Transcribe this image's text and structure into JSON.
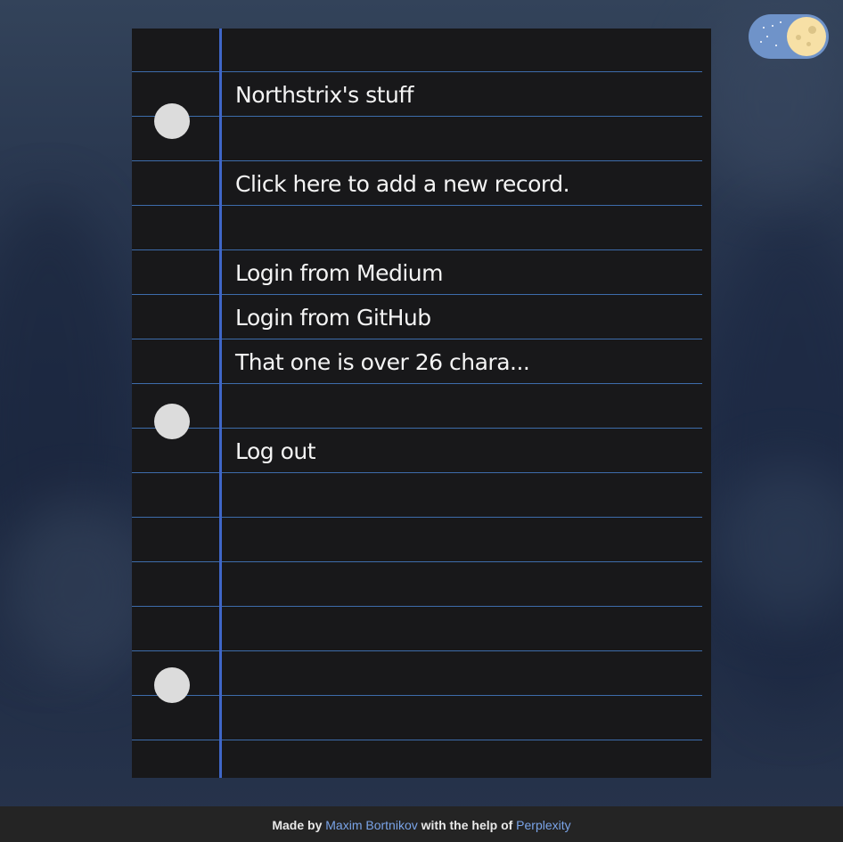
{
  "notebook": {
    "title": "Northstrix's stuff",
    "add_record": "Click here to add a new record.",
    "records": [
      "Login from Medium",
      "Login from GitHub",
      "That one is over 26 chara..."
    ],
    "logout": "Log out"
  },
  "footer": {
    "prefix": "Made by",
    "author": "Maxim Bortnikov",
    "middle": "with the help of",
    "helper": "Perplexity"
  },
  "colors": {
    "paper": "#18181a",
    "rule_line": "#3d6cab",
    "margin_line": "#3f66c8",
    "toggle_track": "#6f93c9",
    "toggle_knob": "#f7e0a6",
    "footer_link": "#7aa4e8"
  },
  "icons": {
    "theme_toggle": "moon-toggle-icon"
  }
}
